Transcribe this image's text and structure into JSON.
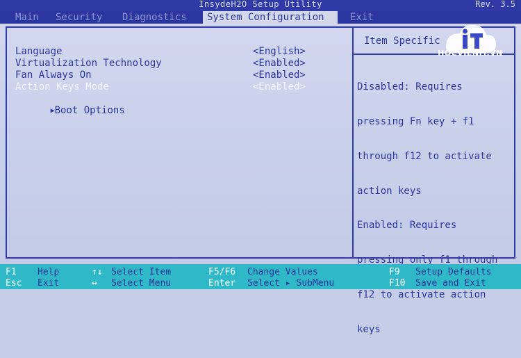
{
  "window": {
    "app_title": "InsydeH2O Setup Utility",
    "revision": "Rev. 3.5"
  },
  "menu": {
    "items": [
      {
        "label": "Main"
      },
      {
        "label": "Security"
      },
      {
        "label": "Diagnostics"
      },
      {
        "label": "System Configuration",
        "active": true
      },
      {
        "label": "Exit"
      }
    ]
  },
  "settings": [
    {
      "label": "Language",
      "value": "<English>"
    },
    {
      "label": "Virtualization Technology",
      "value": "<Enabled>"
    },
    {
      "label": "Fan Always On",
      "value": "<Enabled>"
    },
    {
      "label": "Action Keys Mode",
      "value": "<Enabled>",
      "selected": true
    },
    {
      "label": "Boot Options",
      "submenu": true
    }
  ],
  "help": {
    "title": "Item Specific",
    "lines": [
      "Disabled: Requires",
      "pressing Fn key + f1",
      "through f12 to activate",
      "action keys",
      "Enabled: Requires",
      "pressing only f1 through",
      "f12 to activate action",
      "keys"
    ]
  },
  "keys": [
    {
      "key": "F1",
      "desc": "Help"
    },
    {
      "key": "Esc",
      "desc": "Exit"
    },
    {
      "key": "↑↓",
      "desc": "Select Item"
    },
    {
      "key": "↔",
      "desc": "Select Menu"
    },
    {
      "key": "F5/F6",
      "desc": "Change Values"
    },
    {
      "key": "Enter",
      "desc": "Select ▸ SubMenu"
    },
    {
      "key": "F9",
      "desc": "Setup Defaults"
    },
    {
      "key": "F10",
      "desc": "Save and Exit"
    }
  ],
  "watermark": {
    "text": "HOCVIENIT.VN",
    "icon": "it-logo-icon"
  },
  "colors": {
    "accent": "#2b36a0",
    "key_bar": "#2fb8c8",
    "background": "#c8cfe9"
  }
}
